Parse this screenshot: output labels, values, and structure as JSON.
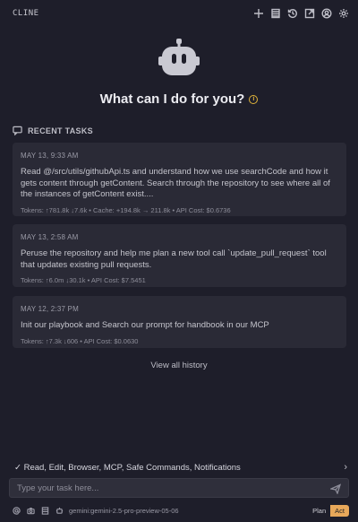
{
  "header": {
    "app_title": "CLINE",
    "icons": [
      "plus-icon",
      "stack-icon",
      "history-icon",
      "external-link-icon",
      "account-icon",
      "settings-icon"
    ]
  },
  "hero": {
    "icon": "robot-icon",
    "title": "What can I do for you?",
    "info_icon": "info-icon"
  },
  "recent_tasks": {
    "heading": "RECENT TASKS",
    "items": [
      {
        "date": "MAY 13, 9:33 AM",
        "text": "Read @/src/utils/githubApi.ts and understand how we use searchCode and how it gets content through getContent. Search through the repository to see where all of the instances of getContent exist....",
        "meta": "Tokens: ↑781.8k ↓7.6k • Cache: +194.8k → 211.8k • API Cost: $0.6736"
      },
      {
        "date": "MAY 13, 2:58 AM",
        "text": "Peruse the repository and help me plan a new tool call `update_pull_request` tool that updates existing pull requests.",
        "meta": "Tokens: ↑6.0m ↓30.1k • API Cost: $7.5451"
      },
      {
        "date": "MAY 12, 2:37 PM",
        "text": "Init our playbook and Search our prompt for handbook in our MCP",
        "meta": "Tokens: ↑7.3k ↓606 • API Cost: $0.0630"
      }
    ],
    "view_all": "View all history"
  },
  "auto_approve": {
    "label": "✓ Read, Edit, Browser, MCP, Safe Commands, Notifications",
    "chevron": "›"
  },
  "input": {
    "placeholder": "Type your task here...",
    "value": ""
  },
  "footer": {
    "model": "gemini:gemini-2.5-pro-preview-05-06",
    "plan_label": "Plan",
    "act_label": "Act",
    "active_mode": "Act"
  },
  "colors": {
    "background": "#1e1e2a",
    "card": "#2a2a36",
    "accent": "#e8a85a",
    "info": "#e0b33a"
  }
}
